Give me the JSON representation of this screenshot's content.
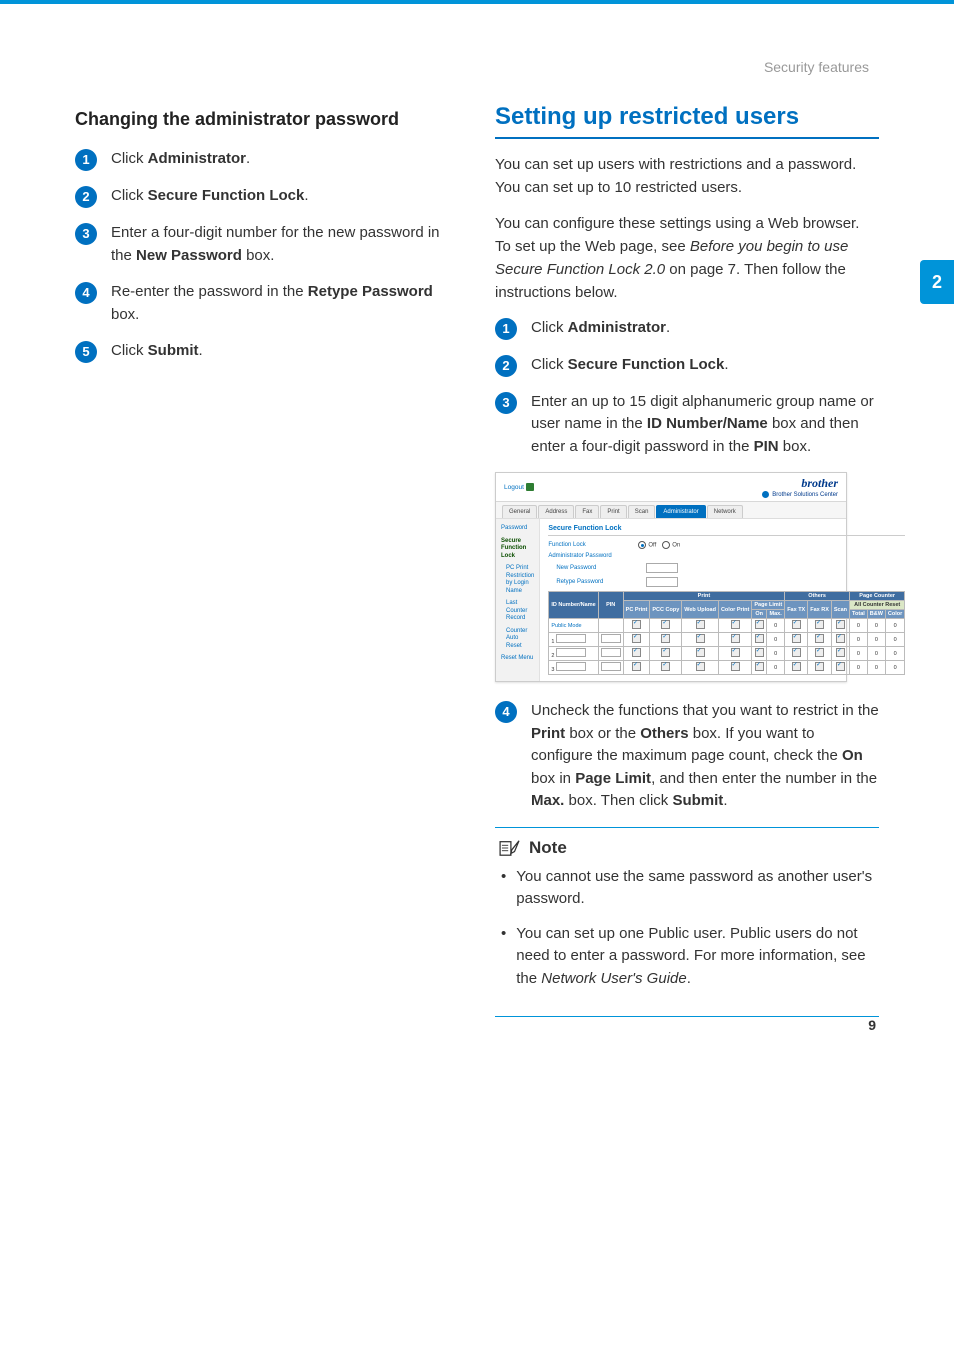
{
  "header": {
    "section": "Security features"
  },
  "side_tab": "2",
  "page_number": "9",
  "left": {
    "heading": "Changing the administrator password",
    "steps": [
      {
        "num": "1",
        "pre": "Click ",
        "bold": "Administrator",
        "post": "."
      },
      {
        "num": "2",
        "pre": "Click ",
        "bold": "Secure Function Lock",
        "post": "."
      },
      {
        "num": "3",
        "text_parts": [
          "Enter a four-digit number for the new password in the ",
          "New Password",
          " box."
        ]
      },
      {
        "num": "4",
        "text_parts": [
          "Re-enter the password in the ",
          "Retype Password",
          " box."
        ]
      },
      {
        "num": "5",
        "pre": "Click ",
        "bold": "Submit",
        "post": "."
      }
    ]
  },
  "right": {
    "heading": "Setting up restricted users",
    "para1": "You can set up users with restrictions and a password. You can set up to 10 restricted users.",
    "para2_a": "You can configure these settings using a Web browser.",
    "para2_b_pre": "To set up the Web page, see ",
    "para2_b_italic": "Before you begin to use Secure Function Lock 2.0",
    "para2_b_post": " on page 7. Then follow the instructions below.",
    "steps_a": [
      {
        "num": "1",
        "pre": "Click ",
        "bold": "Administrator",
        "post": "."
      },
      {
        "num": "2",
        "pre": "Click ",
        "bold": "Secure Function Lock",
        "post": "."
      },
      {
        "num": "3",
        "text_parts": [
          "Enter an up to 15 digit alphanumeric group name or user name in the ",
          "ID Number/Name",
          " box and then enter a four-digit password in the ",
          "PIN",
          " box."
        ]
      }
    ],
    "screenshot": {
      "logout": "Logout",
      "brand": "brother",
      "solutions_center": "Brother Solutions Center",
      "tabs": [
        "General",
        "Address",
        "Fax",
        "Print",
        "Scan",
        "Administrator",
        "Network"
      ],
      "active_tab_index": 5,
      "sidebar": {
        "items": [
          {
            "label": "Password",
            "sub": false
          },
          {
            "label": "Secure Function Lock",
            "sub": false,
            "active": true
          },
          {
            "label": "PC Print Restriction by Login Name",
            "sub": true
          },
          {
            "label": "Last Counter Record",
            "sub": true
          },
          {
            "label": "Counter Auto Reset",
            "sub": true
          },
          {
            "label": "Reset Menu",
            "sub": false
          }
        ]
      },
      "main_title": "Secure Function Lock",
      "rows": {
        "function_lock": {
          "label": "Function Lock",
          "opt_off": "Off",
          "opt_on": "On"
        },
        "admin_pwd": {
          "label": "Administrator Password"
        },
        "new_pwd": {
          "label": "New Password"
        },
        "retype_pwd": {
          "label": "Retype Password"
        }
      },
      "table": {
        "group1": [
          "Print",
          "",
          "Others",
          "Page Counter"
        ],
        "group2": [
          "ID Number/Name",
          "PIN",
          "PC Print",
          "PCC Copy",
          "",
          "Web Upload",
          "",
          "Color Print",
          "Page Limit",
          "",
          "Fax TX",
          "Fax RX",
          "Scan",
          "",
          "Total",
          "B&W",
          "Color"
        ],
        "sub_pagelimit": [
          "On",
          "Max."
        ],
        "reset_btn": "All Counter Reset",
        "row_labels": [
          "Public Mode",
          "1",
          "2",
          "3"
        ]
      }
    },
    "step4": {
      "num": "4",
      "parts": [
        "Uncheck the functions that you want to restrict in the ",
        "Print",
        " box or the ",
        "Others",
        " box. If you want to configure the maximum page count, check the ",
        "On",
        " box in ",
        "Page Limit",
        ", and then enter the number in the ",
        "Max.",
        " box. Then click ",
        "Submit",
        "."
      ]
    },
    "note": {
      "title": "Note",
      "bullets": [
        "You cannot use the same password as another user's password.",
        {
          "pre": "You can set up one Public user. Public users do not need to enter a password. For more information, see the ",
          "italic": "Network User's Guide",
          "post": "."
        }
      ]
    }
  }
}
